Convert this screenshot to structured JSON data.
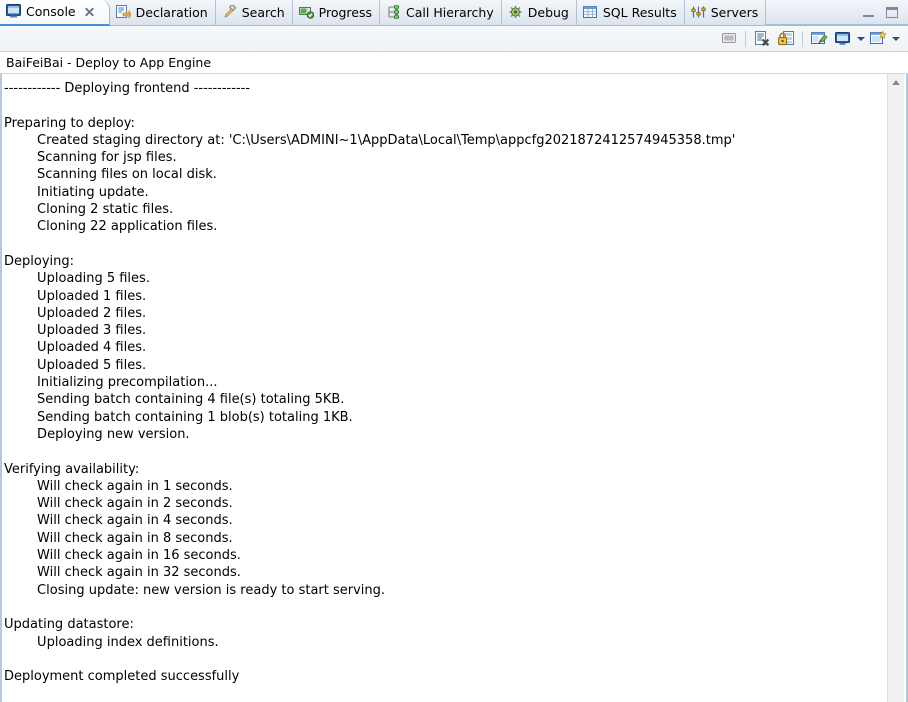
{
  "window": {
    "minimize_label": "Minimize",
    "maximize_label": "Maximize"
  },
  "tabs": [
    {
      "label": "Console",
      "icon": "console-icon",
      "active": true,
      "closable": true
    },
    {
      "label": "Declaration",
      "icon": "declaration-icon",
      "active": false,
      "closable": false
    },
    {
      "label": "Search",
      "icon": "search-icon",
      "active": false,
      "closable": false
    },
    {
      "label": "Progress",
      "icon": "progress-icon",
      "active": false,
      "closable": false
    },
    {
      "label": "Call Hierarchy",
      "icon": "call-hierarchy-icon",
      "active": false,
      "closable": false
    },
    {
      "label": "Debug",
      "icon": "debug-icon",
      "active": false,
      "closable": false
    },
    {
      "label": "SQL Results",
      "icon": "sql-results-icon",
      "active": false,
      "closable": false
    },
    {
      "label": "Servers",
      "icon": "servers-icon",
      "active": false,
      "closable": false
    }
  ],
  "toolbar": {
    "buttons": [
      {
        "name": "terminate-button",
        "icon": "terminate-icon",
        "tooltip": "Terminate"
      },
      {
        "name": "clear-console-button",
        "icon": "clear-console-icon",
        "tooltip": "Clear Console"
      },
      {
        "name": "scroll-lock-button",
        "icon": "scroll-lock-icon",
        "tooltip": "Scroll Lock"
      },
      {
        "name": "pin-console-button",
        "icon": "pin-console-icon",
        "tooltip": "Pin Console"
      },
      {
        "name": "display-console-button",
        "icon": "display-console-icon",
        "tooltip": "Display Selected Console"
      },
      {
        "name": "open-console-button",
        "icon": "open-console-icon",
        "tooltip": "Open Console"
      }
    ]
  },
  "console": {
    "title": "BaiFeiBai - Deploy to App Engine",
    "lines": [
      "------------ Deploying frontend ------------",
      "",
      "Preparing to deploy:",
      "        Created staging directory at: 'C:\\Users\\ADMINI~1\\AppData\\Local\\Temp\\appcfg2021872412574945358.tmp'",
      "        Scanning for jsp files.",
      "        Scanning files on local disk.",
      "        Initiating update.",
      "        Cloning 2 static files.",
      "        Cloning 22 application files.",
      "",
      "Deploying:",
      "        Uploading 5 files.",
      "        Uploaded 1 files.",
      "        Uploaded 2 files.",
      "        Uploaded 3 files.",
      "        Uploaded 4 files.",
      "        Uploaded 5 files.",
      "        Initializing precompilation...",
      "        Sending batch containing 4 file(s) totaling 5KB.",
      "        Sending batch containing 1 blob(s) totaling 1KB.",
      "        Deploying new version.",
      "",
      "Verifying availability:",
      "        Will check again in 1 seconds.",
      "        Will check again in 2 seconds.",
      "        Will check again in 4 seconds.",
      "        Will check again in 8 seconds.",
      "        Will check again in 16 seconds.",
      "        Will check again in 32 seconds.",
      "        Closing update: new version is ready to start serving.",
      "",
      "Updating datastore:",
      "        Uploading index definitions.",
      "",
      "Deployment completed successfully"
    ]
  },
  "scrollbar": {
    "up_arrow_label": "Scroll up"
  },
  "colors": {
    "tab_active_underline": "#4a90d9",
    "tabbar_bg": "#e6ecf3",
    "console_bg": "#ffffff",
    "text": "#000000",
    "border": "#a5bcd4"
  }
}
